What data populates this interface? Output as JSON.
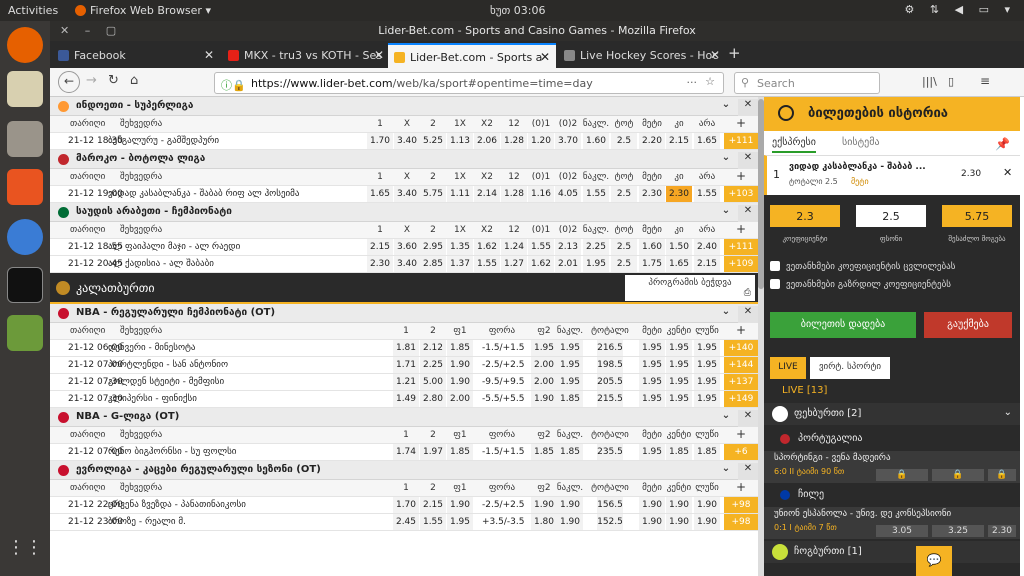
{
  "desktop": {
    "activities": "Activities",
    "app_menu": "Firefox Web Browser ▾",
    "clock": "ხუთ 03:06",
    "tray": "⚙ ⇅ ◀ ▭ ▾"
  },
  "window": {
    "title": "Lider-Bet.com - Sports and Casino Games - Mozilla Firefox"
  },
  "tabs": [
    {
      "label": "Facebook",
      "color": "#3b5998"
    },
    {
      "label": "MKX - tru3 vs KOTH - Ses",
      "color": "#e62117"
    },
    {
      "label": "Lider-Bet.com - Sports a",
      "color": "#f5b323"
    },
    {
      "label": "Live Hockey Scores - Hoc",
      "color": "#555555"
    }
  ],
  "nav": {
    "url_host": "https://www.lider-bet.com",
    "url_path": "/web/ka/sport#opentime=time=day",
    "search_placeholder": "Search"
  },
  "groups": [
    {
      "title": "ინდოეთი - სუპერლიგა",
      "flag": "#ff9933",
      "header": [
        "თარიღი",
        "შეხვედრა",
        "1",
        "X",
        "2",
        "1X",
        "X2",
        "12",
        "(0)1",
        "(0)2",
        "ნაკლ.",
        "ტოტ",
        "მეტი",
        "კი",
        "არა"
      ],
      "rows": [
        [
          "21-12 18:30",
          "ბენგალურუ - გამშედპური",
          "1.70",
          "3.40",
          "5.25",
          "1.13",
          "2.06",
          "1.28",
          "1.20",
          "3.70",
          "1.60",
          "2.5",
          "2.20",
          "2.15",
          "1.65",
          "+111"
        ]
      ]
    },
    {
      "title": "მაროკო - ბოტოლა ლიგა",
      "flag": "#c1272d",
      "header": [
        "თარიღი",
        "შეხვედრა",
        "1",
        "X",
        "2",
        "1X",
        "X2",
        "12",
        "(0)1",
        "(0)2",
        "ნაკლ.",
        "ტოტ",
        "მეტი",
        "კი",
        "არა"
      ],
      "rows": [
        [
          "21-12 19:00",
          "ვიდად კასაბლანკა - შაბაბ რიფ ალ ჰოსეიმა",
          "1.65",
          "3.40",
          "5.75",
          "1.11",
          "2.14",
          "1.28",
          "1.16",
          "4.05",
          "1.55",
          "2.5",
          "2.30",
          "2.30",
          "1.55",
          "+103"
        ]
      ]
    },
    {
      "title": "საუდის არაბეთი - ჩემპიონატი",
      "flag": "#006c35",
      "header": [
        "თარიღი",
        "შეხვედრა",
        "1",
        "X",
        "2",
        "1X",
        "X2",
        "12",
        "(0)1",
        "(0)2",
        "ნაკლ.",
        "ტოტ",
        "მეტი",
        "კი",
        "არა"
      ],
      "rows": [
        [
          "21-12 18:55",
          "ალ ფაიჰალი მაჯი - ალ რაედი",
          "2.15",
          "3.60",
          "2.95",
          "1.35",
          "1.62",
          "1.24",
          "1.55",
          "2.13",
          "2.25",
          "2.5",
          "1.60",
          "1.50",
          "2.40",
          "+111"
        ],
        [
          "21-12 20:45",
          "ალ ქადისია - ალ შაბაბი",
          "2.30",
          "3.40",
          "2.85",
          "1.37",
          "1.55",
          "1.27",
          "1.62",
          "2.01",
          "1.95",
          "2.5",
          "1.75",
          "1.65",
          "2.15",
          "+109"
        ]
      ]
    }
  ],
  "banner": {
    "title": "კალათბურთი",
    "programs": "პროგრამის ბეჭდვა"
  },
  "bgroups": [
    {
      "title": "NBA - რეგულარული ჩემპიონატი (OT)",
      "header": [
        "თარიღი",
        "შეხვედრა",
        "1",
        "2",
        "ფ1",
        "ფორა",
        "ფ2",
        "ნაკლ.",
        "ტოტალი",
        "მეტი",
        "კენტი",
        "ლუწი"
      ],
      "rows": [
        [
          "21-12 06:00",
          "დენვერი - მინესოტა",
          "1.81",
          "2.12",
          "1.85",
          "-1.5/+1.5",
          "1.95",
          "1.95",
          "216.5",
          "1.95",
          "1.95",
          "1.95",
          "+140"
        ],
        [
          "21-12 07:00",
          "პორტლენდი - სან ანტონიო",
          "1.71",
          "2.25",
          "1.90",
          "-2.5/+2.5",
          "2.00",
          "1.95",
          "198.5",
          "1.95",
          "1.95",
          "1.95",
          "+144"
        ],
        [
          "21-12 07:30",
          "გოლდენ სტეიტი - მემფისი",
          "1.21",
          "5.00",
          "1.90",
          "-9.5/+9.5",
          "2.00",
          "1.95",
          "205.5",
          "1.95",
          "1.95",
          "1.95",
          "+137"
        ],
        [
          "21-12 07:30",
          "კლიპერსი - ფინიქსი",
          "1.49",
          "2.80",
          "2.00",
          "-5.5/+5.5",
          "1.90",
          "1.85",
          "215.5",
          "1.95",
          "1.95",
          "1.95",
          "+149"
        ]
      ]
    },
    {
      "title": "NBA - G-ლიგა (OT)",
      "header": [
        "თარიღი",
        "შეხვედრა",
        "1",
        "2",
        "ფ1",
        "ფორა",
        "ფ2",
        "ნაკლ.",
        "ტოტალი",
        "მეტი",
        "კენტი",
        "ლუწი"
      ],
      "rows": [
        [
          "21-12 07:00",
          "რენო ბიგჰორნსი - სუ ფოლსი",
          "1.74",
          "1.97",
          "1.85",
          "-1.5/+1.5",
          "1.85",
          "1.85",
          "235.5",
          "1.95",
          "1.85",
          "1.85",
          "+6"
        ]
      ]
    },
    {
      "title": "ევროლიგა - კაცები რეგულარული სეზონი (OT)",
      "header": [
        "თარიღი",
        "შეხვედრა",
        "1",
        "2",
        "ფ1",
        "ფორა",
        "ფ2",
        "ნაკლ.",
        "ტოტალი",
        "მეტი",
        "კენტი",
        "ლუწი"
      ],
      "rows": [
        [
          "21-12 22:00",
          "ცრვენა ზვეზდა - პანათინაიკოსი",
          "1.70",
          "2.15",
          "1.90",
          "-2.5/+2.5",
          "1.90",
          "1.90",
          "156.5",
          "1.90",
          "1.90",
          "1.90",
          "+98"
        ],
        [
          "21-12 23:00",
          "ბროზე - რეალი მ.",
          "2.45",
          "1.55",
          "1.95",
          "+3.5/-3.5",
          "1.80",
          "1.90",
          "152.5",
          "1.90",
          "1.90",
          "1.90",
          "+98"
        ]
      ]
    }
  ],
  "side": {
    "history": "ბილეთების ისტორია",
    "tab1": "ექსპრესი",
    "tab2": "სისტემა",
    "bet": {
      "num": "1",
      "match": "ვიდად კასაბლანკა - შაბაბ ...",
      "type": "ტოტალი 2.5",
      "pick": "მეტი",
      "odd": "2.30"
    },
    "coef": "2.3",
    "amount": "2.5",
    "win": "5.75",
    "coef_lbl": "კოეფიციენტი",
    "amount_lbl": "ფსონი",
    "win_lbl": "შესაძლო მოგება",
    "chk1": "ვეთანხმები კოეფიციენტის ცვლილებას",
    "chk2": "ვეთანხმები გაზრდილ კოეფიციენტებს",
    "place": "ბილეთის დადება",
    "clear": "გაუქმება",
    "live_tab": "LIVE",
    "virtual_tab": "ვირტ. სპორტი",
    "live_count": "LIVE [13]",
    "football": "ფეხბურთი [2]",
    "portugal": "პორტუგალია",
    "m1": "სპორტინგი - ვენა მადეირა",
    "m1_score": "6:0 II ტაიმი 90 წთ",
    "chile": "ჩილე",
    "m2": "უნიონ ესპანოლა - უნივ. დე კონსეპსიონი",
    "m2_score": "0:1 I ტაიმი 7 წთ",
    "m2_odds": [
      "3.05",
      "3.25",
      "2.30"
    ],
    "tennis": "ჩოგბურთი [1]"
  }
}
